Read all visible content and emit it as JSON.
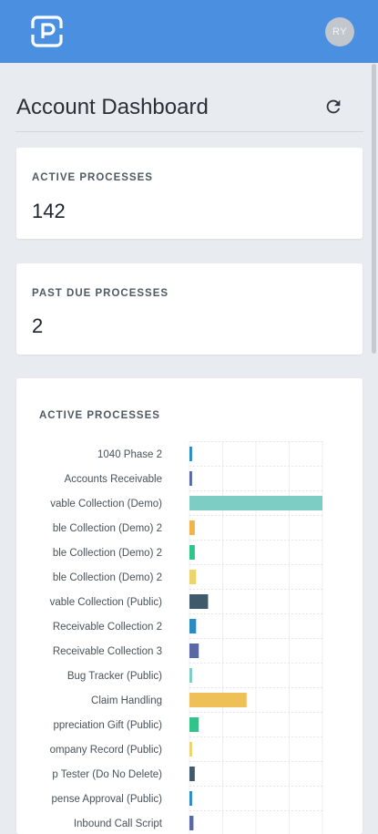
{
  "header": {
    "avatar_initials": "RY",
    "logo_icon": "p-logo-icon",
    "background_color": "#4a8fe0"
  },
  "page": {
    "title": "Account Dashboard",
    "refresh_icon": "refresh-icon"
  },
  "stats": [
    {
      "label": "ACTIVE PROCESSES",
      "value": "142"
    },
    {
      "label": "PAST DUE PROCESSES",
      "value": "2"
    }
  ],
  "chart_data": {
    "type": "bar",
    "orientation": "horizontal",
    "title": "ACTIVE PROCESSES",
    "grid": true,
    "xlim": [
      0,
      100
    ],
    "categories": [
      "1040 Phase 2",
      "Accounts Receivable",
      "vable Collection (Demo)",
      "ble Collection (Demo) 2",
      "ble Collection (Demo) 2",
      "ble Collection (Demo) 2",
      "vable Collection (Public)",
      "Receivable Collection 2",
      "Receivable Collection 3",
      "Bug Tracker (Public)",
      "Claim Handling",
      "ppreciation Gift (Public)",
      "ompany Record (Public)",
      "p Tester (Do No Delete)",
      "pense Approval (Public)",
      "Inbound Call Script"
    ],
    "values": [
      2,
      2,
      100,
      4,
      4,
      5,
      14,
      5,
      7,
      2,
      43,
      7,
      2,
      4,
      2,
      3
    ],
    "colors": [
      "#2b8cc4",
      "#5a68a8",
      "#7dcdc4",
      "#f0b44a",
      "#2fc48a",
      "#ecd56a",
      "#3f5b6b",
      "#2b8cc4",
      "#5a68a8",
      "#7dcdc4",
      "#f0c058",
      "#2fc48a",
      "#ecd56a",
      "#3f5b6b",
      "#2b8cc4",
      "#5a68a8"
    ]
  }
}
